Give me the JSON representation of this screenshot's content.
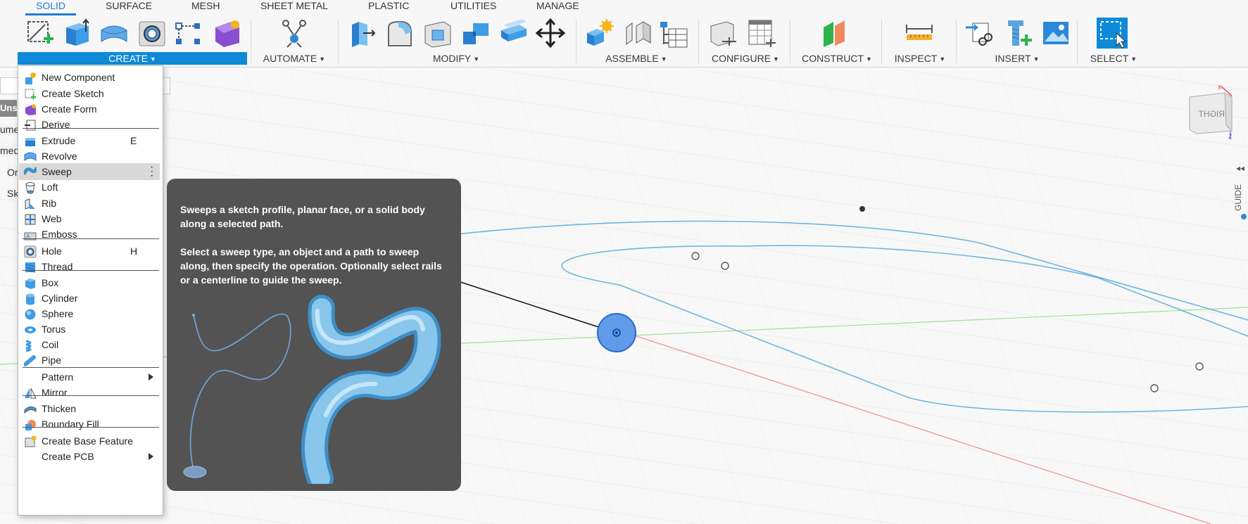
{
  "toolbar": {
    "tabs": [
      "SOLID",
      "SURFACE",
      "MESH",
      "SHEET METAL",
      "PLASTIC",
      "UTILITIES",
      "MANAGE"
    ],
    "groups": [
      "CREATE",
      "AUTOMATE",
      "MODIFY",
      "ASSEMBLE",
      "CONFIGURE",
      "CONSTRUCT",
      "INSPECT",
      "INSERT",
      "SELECT"
    ]
  },
  "left_panel": {
    "items": [
      "Unsa",
      "ume",
      "med",
      "Or",
      "Sk"
    ]
  },
  "create_menu": {
    "items": [
      {
        "label": "New Component",
        "icon": "new-component-icon"
      },
      {
        "label": "Create Sketch",
        "icon": "create-sketch-icon"
      },
      {
        "label": "Create Form",
        "icon": "create-form-icon"
      },
      {
        "label": "Derive",
        "icon": "derive-icon"
      },
      {
        "label": "Extrude",
        "icon": "extrude-icon",
        "shortcut": "E"
      },
      {
        "label": "Revolve",
        "icon": "revolve-icon"
      },
      {
        "label": "Sweep",
        "icon": "sweep-icon",
        "highlighted": true
      },
      {
        "label": "Loft",
        "icon": "loft-icon"
      },
      {
        "label": "Rib",
        "icon": "rib-icon"
      },
      {
        "label": "Web",
        "icon": "web-icon"
      },
      {
        "label": "Emboss",
        "icon": "emboss-icon"
      },
      {
        "label": "Hole",
        "icon": "hole-icon",
        "shortcut": "H"
      },
      {
        "label": "Thread",
        "icon": "thread-icon"
      },
      {
        "label": "Box",
        "icon": "box-icon"
      },
      {
        "label": "Cylinder",
        "icon": "cylinder-icon"
      },
      {
        "label": "Sphere",
        "icon": "sphere-icon"
      },
      {
        "label": "Torus",
        "icon": "torus-icon"
      },
      {
        "label": "Coil",
        "icon": "coil-icon"
      },
      {
        "label": "Pipe",
        "icon": "pipe-icon"
      },
      {
        "label": "Pattern",
        "icon": "",
        "submenu": true
      },
      {
        "label": "Mirror",
        "icon": "mirror-icon"
      },
      {
        "label": "Thicken",
        "icon": "thicken-icon"
      },
      {
        "label": "Boundary Fill",
        "icon": "boundary-fill-icon"
      },
      {
        "label": "Create Base Feature",
        "icon": "create-base-feature-icon"
      },
      {
        "label": "Create PCB",
        "icon": "",
        "submenu": true
      }
    ]
  },
  "tooltip": {
    "line1": "Sweeps a sketch profile, planar face, or a solid body along a selected path.",
    "line2": "Select a sweep type, an object and a path to sweep along, then specify the operation. Optionally select rails or a centerline to guide the sweep."
  },
  "viewcube": {
    "face": "RIGHT"
  },
  "side_guide": "GUIDE",
  "colors": {
    "accent": "#0e8ad8",
    "sketch_curve": "#6fb6de",
    "tooltip_bg": "#535353"
  }
}
